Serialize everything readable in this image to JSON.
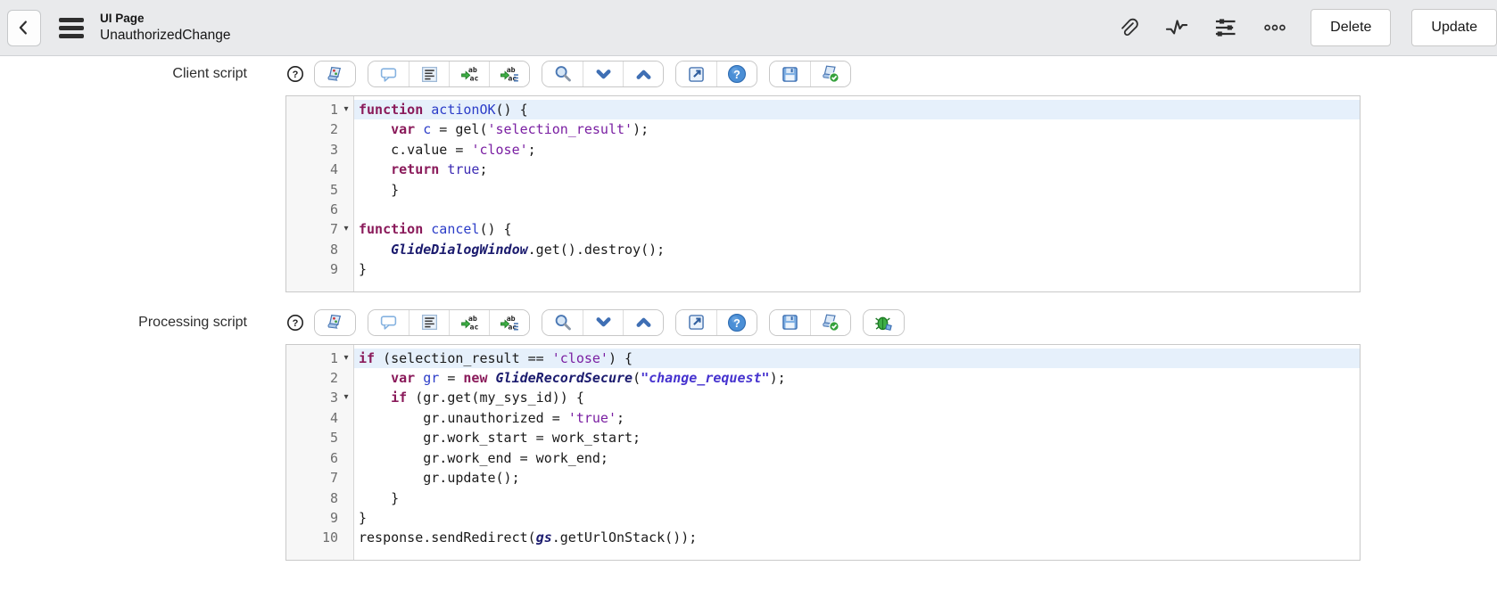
{
  "header": {
    "title": "UI Page",
    "record_name": "UnauthorizedChange",
    "icons": [
      "back-icon",
      "menu-icon",
      "attachment-icon",
      "activity-stream-icon",
      "personalize-form-icon",
      "more-options-icon"
    ],
    "buttons": {
      "delete": "Delete",
      "update": "Update"
    }
  },
  "colors": {
    "header_bg": "#e9eaec",
    "active_line_bg": "#e6f0fb",
    "keyword": "#8a1a5a",
    "definition": "#2b3cc8",
    "string": "#7a1fa2",
    "atom": "#3c2bb3",
    "api_class": "#1b1b6e",
    "string_bold": "#4633cf",
    "toolbar_icon_blue": "#4a77b3",
    "check_green": "#35a13c",
    "debugger_green": "#3fae46"
  },
  "fields": [
    {
      "label": "Client script",
      "help_icon": "field-help-icon",
      "toolbar_groups": [
        [
          "script-field"
        ],
        [
          "toggle-comment",
          "format-code",
          "replace",
          "replace-all"
        ],
        [
          "search",
          "find-next",
          "find-previous"
        ],
        [
          "open-fullscreen",
          "editor-help"
        ],
        [
          "save",
          "syntax-check"
        ]
      ],
      "editor": {
        "lines": [
          {
            "num": 1,
            "fold": true,
            "active": true,
            "tokens": [
              [
                "k",
                "function"
              ],
              [
                "p",
                " "
              ],
              [
                "d",
                "actionOK"
              ],
              [
                "p",
                "() {"
              ]
            ]
          },
          {
            "num": 2,
            "fold": false,
            "active": false,
            "tokens": [
              [
                "p",
                "    "
              ],
              [
                "k",
                "var"
              ],
              [
                "p",
                " "
              ],
              [
                "d",
                "c"
              ],
              [
                "p",
                " = gel("
              ],
              [
                "s",
                "'selection_result'"
              ],
              [
                "p",
                ");"
              ]
            ]
          },
          {
            "num": 3,
            "fold": false,
            "active": false,
            "tokens": [
              [
                "p",
                "    c.value = "
              ],
              [
                "s",
                "'close'"
              ],
              [
                "p",
                ";"
              ]
            ]
          },
          {
            "num": 4,
            "fold": false,
            "active": false,
            "tokens": [
              [
                "p",
                "    "
              ],
              [
                "k",
                "return"
              ],
              [
                "p",
                " "
              ],
              [
                "a",
                "true"
              ],
              [
                "p",
                ";"
              ]
            ]
          },
          {
            "num": 5,
            "fold": false,
            "active": false,
            "tokens": [
              [
                "p",
                "    }"
              ]
            ]
          },
          {
            "num": 6,
            "fold": false,
            "active": false,
            "tokens": [
              [
                "p",
                ""
              ]
            ]
          },
          {
            "num": 7,
            "fold": true,
            "active": false,
            "tokens": [
              [
                "k",
                "function"
              ],
              [
                "p",
                " "
              ],
              [
                "d",
                "cancel"
              ],
              [
                "p",
                "() {"
              ]
            ]
          },
          {
            "num": 8,
            "fold": false,
            "active": false,
            "tokens": [
              [
                "p",
                "    "
              ],
              [
                "v",
                "GlideDialogWindow"
              ],
              [
                "p",
                ".get().destroy();"
              ]
            ]
          },
          {
            "num": 9,
            "fold": false,
            "active": false,
            "tokens": [
              [
                "p",
                "}"
              ]
            ]
          }
        ]
      }
    },
    {
      "label": "Processing script",
      "help_icon": "field-help-icon",
      "toolbar_groups": [
        [
          "script-field"
        ],
        [
          "toggle-comment",
          "format-code",
          "replace",
          "replace-all"
        ],
        [
          "search",
          "find-next",
          "find-previous"
        ],
        [
          "open-fullscreen",
          "editor-help"
        ],
        [
          "save",
          "syntax-check"
        ],
        [
          "script-debugger"
        ]
      ],
      "editor": {
        "lines": [
          {
            "num": 1,
            "fold": true,
            "active": true,
            "tokens": [
              [
                "k",
                "if"
              ],
              [
                "p",
                " (selection_result == "
              ],
              [
                "s",
                "'close'"
              ],
              [
                "p",
                ") {"
              ]
            ]
          },
          {
            "num": 2,
            "fold": false,
            "active": false,
            "tokens": [
              [
                "p",
                "    "
              ],
              [
                "k",
                "var"
              ],
              [
                "p",
                " "
              ],
              [
                "d",
                "gr"
              ],
              [
                "p",
                " = "
              ],
              [
                "k",
                "new"
              ],
              [
                "p",
                " "
              ],
              [
                "v",
                "GlideRecordSecure"
              ],
              [
                "p",
                "("
              ],
              [
                "sb",
                "\"change_request\""
              ],
              [
                "p",
                ");"
              ]
            ]
          },
          {
            "num": 3,
            "fold": true,
            "active": false,
            "tokens": [
              [
                "p",
                "    "
              ],
              [
                "k",
                "if"
              ],
              [
                "p",
                " (gr.get(my_sys_id)) {"
              ]
            ]
          },
          {
            "num": 4,
            "fold": false,
            "active": false,
            "tokens": [
              [
                "p",
                "        gr.unauthorized = "
              ],
              [
                "s",
                "'true'"
              ],
              [
                "p",
                ";"
              ]
            ]
          },
          {
            "num": 5,
            "fold": false,
            "active": false,
            "tokens": [
              [
                "p",
                "        gr.work_start = work_start;"
              ]
            ]
          },
          {
            "num": 6,
            "fold": false,
            "active": false,
            "tokens": [
              [
                "p",
                "        gr.work_end = work_end;"
              ]
            ]
          },
          {
            "num": 7,
            "fold": false,
            "active": false,
            "tokens": [
              [
                "p",
                "        gr.update();"
              ]
            ]
          },
          {
            "num": 8,
            "fold": false,
            "active": false,
            "tokens": [
              [
                "p",
                "    }"
              ]
            ]
          },
          {
            "num": 9,
            "fold": false,
            "active": false,
            "tokens": [
              [
                "p",
                "}"
              ]
            ]
          },
          {
            "num": 10,
            "fold": false,
            "active": false,
            "tokens": [
              [
                "p",
                "response.sendRedirect("
              ],
              [
                "v",
                "gs"
              ],
              [
                "p",
                ".getUrlOnStack());"
              ]
            ]
          }
        ]
      }
    }
  ]
}
